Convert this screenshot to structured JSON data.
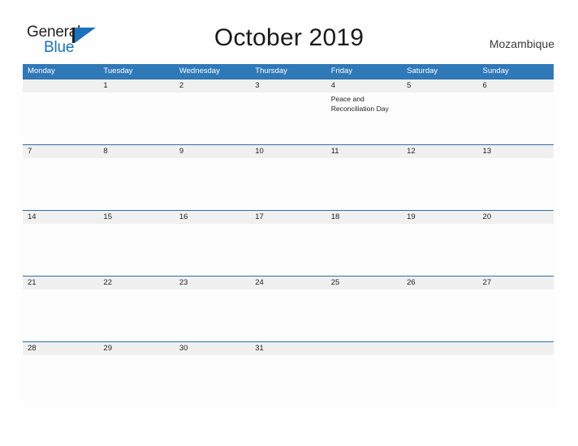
{
  "brand": {
    "name_part1": "General",
    "name_part2": "Blue",
    "mark_icon": "triangle-flag-icon",
    "accent_color": "#1b72bb"
  },
  "header": {
    "title": "October 2019",
    "country": "Mozambique"
  },
  "colors": {
    "header_blue": "#3079b8",
    "row_divider_blue": "#2e6da4",
    "date_band_gray": "#f0f0f0",
    "page_background": "#fefefe",
    "text_dark": "#232323"
  },
  "calendar": {
    "month": "October",
    "year": "2019",
    "day_headers": [
      "Monday",
      "Tuesday",
      "Wednesday",
      "Thursday",
      "Friday",
      "Saturday",
      "Sunday"
    ],
    "weeks": [
      {
        "days": [
          {
            "num": "",
            "event": ""
          },
          {
            "num": "1",
            "event": ""
          },
          {
            "num": "2",
            "event": ""
          },
          {
            "num": "3",
            "event": ""
          },
          {
            "num": "4",
            "event": "Peace and Reconciliation Day"
          },
          {
            "num": "5",
            "event": ""
          },
          {
            "num": "6",
            "event": ""
          }
        ]
      },
      {
        "days": [
          {
            "num": "7",
            "event": ""
          },
          {
            "num": "8",
            "event": ""
          },
          {
            "num": "9",
            "event": ""
          },
          {
            "num": "10",
            "event": ""
          },
          {
            "num": "11",
            "event": ""
          },
          {
            "num": "12",
            "event": ""
          },
          {
            "num": "13",
            "event": ""
          }
        ]
      },
      {
        "days": [
          {
            "num": "14",
            "event": ""
          },
          {
            "num": "15",
            "event": ""
          },
          {
            "num": "16",
            "event": ""
          },
          {
            "num": "17",
            "event": ""
          },
          {
            "num": "18",
            "event": ""
          },
          {
            "num": "19",
            "event": ""
          },
          {
            "num": "20",
            "event": ""
          }
        ]
      },
      {
        "days": [
          {
            "num": "21",
            "event": ""
          },
          {
            "num": "22",
            "event": ""
          },
          {
            "num": "23",
            "event": ""
          },
          {
            "num": "24",
            "event": ""
          },
          {
            "num": "25",
            "event": ""
          },
          {
            "num": "26",
            "event": ""
          },
          {
            "num": "27",
            "event": ""
          }
        ]
      },
      {
        "days": [
          {
            "num": "28",
            "event": ""
          },
          {
            "num": "29",
            "event": ""
          },
          {
            "num": "30",
            "event": ""
          },
          {
            "num": "31",
            "event": ""
          },
          {
            "num": "",
            "event": ""
          },
          {
            "num": "",
            "event": ""
          },
          {
            "num": "",
            "event": ""
          }
        ]
      }
    ]
  }
}
